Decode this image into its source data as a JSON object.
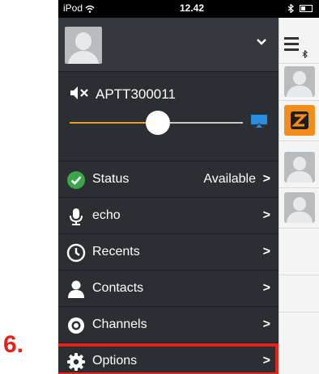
{
  "annotation": {
    "step": "6."
  },
  "statusbar": {
    "device": "iPod",
    "time": "12.42"
  },
  "channel": {
    "name": "APTT300011",
    "volume_percent": 45
  },
  "menu": {
    "status": {
      "label": "Status",
      "value": "Available"
    },
    "items": [
      {
        "label": "echo",
        "icon": "microphone-icon"
      },
      {
        "label": "Recents",
        "icon": "clock-icon"
      },
      {
        "label": "Contacts",
        "icon": "person-icon"
      },
      {
        "label": "Channels",
        "icon": "channels-icon"
      },
      {
        "label": "Options",
        "icon": "gear-icon"
      }
    ],
    "chevron": ">"
  },
  "colors": {
    "menu_bg": "#2b2e33",
    "accent_orange": "#f0a020",
    "status_green": "#3aa54a",
    "airplay_blue": "#2a8de0",
    "highlight_red": "#e8201a"
  }
}
